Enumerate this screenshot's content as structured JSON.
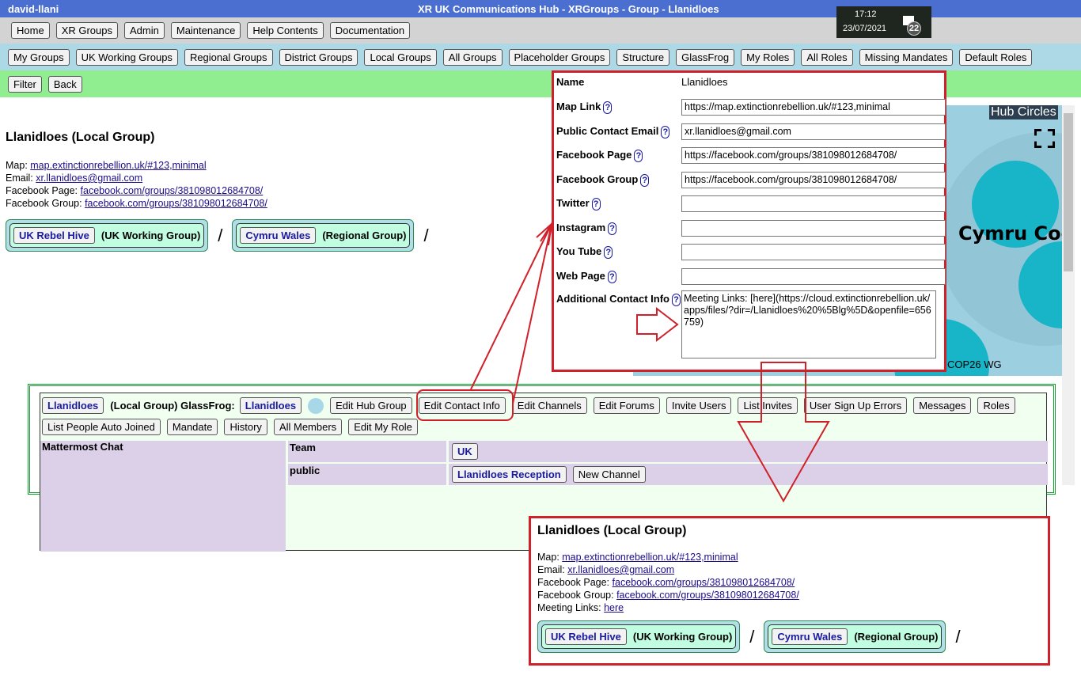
{
  "titlebar": {
    "user": "david-llani",
    "title": "XR UK Communications Hub - XRGroups - Group - Llanidloes"
  },
  "clock": {
    "time": "17:12",
    "date": "23/07/2021",
    "notifications": "22",
    "icon": "notification-icon"
  },
  "nav1": [
    "Home",
    "XR Groups",
    "Admin",
    "Maintenance",
    "Help Contents",
    "Documentation"
  ],
  "nav2": [
    "My Groups",
    "UK Working Groups",
    "Regional Groups",
    "District Groups",
    "Local Groups",
    "All Groups",
    "Placeholder Groups",
    "Structure",
    "GlassFrog",
    "My Roles",
    "All Roles",
    "Missing Mandates",
    "Default Roles"
  ],
  "nav3": [
    "Filter",
    "Back"
  ],
  "group": {
    "title": "Llanidloes (Local Group)",
    "map_label": "Map: ",
    "map": "map.extinctionrebellion.uk/#123,minimal",
    "email_label": "Email: ",
    "email": "xr.llanidloes@gmail.com",
    "fbpage_label": "Facebook Page: ",
    "fbpage": "facebook.com/groups/381098012684708/",
    "fbgroup_label": "Facebook Group: ",
    "fbgroup": "facebook.com/groups/381098012684708/",
    "meeting_label": "Meeting Links: ",
    "meeting": "here",
    "parents": [
      {
        "name": "UK Rebel Hive",
        "type": "(UK Working Group)"
      },
      {
        "name": "Cymru Wales",
        "type": "(Regional Group)"
      }
    ],
    "separator": "/"
  },
  "form": {
    "help": "?",
    "name_label": "Name",
    "name_value": "Llanidloes",
    "fields": [
      {
        "label": "Map Link",
        "value": "https://map.extinctionrebellion.uk/#123,minimal"
      },
      {
        "label": "Public Contact Email",
        "value": "xr.llanidloes@gmail.com"
      },
      {
        "label": "Facebook Page",
        "value": "https://facebook.com/groups/381098012684708/"
      },
      {
        "label": "Facebook Group",
        "value": "https://facebook.com/groups/381098012684708/"
      },
      {
        "label": "Twitter",
        "value": ""
      },
      {
        "label": "Instagram",
        "value": ""
      },
      {
        "label": "You Tube",
        "value": ""
      },
      {
        "label": "Web Page",
        "value": ""
      }
    ],
    "additional_label": "Additional Contact Info",
    "additional_value": "Meeting Links: [here](https://cloud.extinctionrebellion.uk/apps/files/?dir=/Llanidloes%20%5Blg%5D&openfile=656759)"
  },
  "hub": {
    "title": "Hub Circles",
    "circle_label": "Cymru Coo",
    "small_label": "COP26 WG",
    "expand_icon": "fullscreen-icon"
  },
  "hubgroup": {
    "name": "Llanidloes",
    "type": "(Local Group) GlassFrog:",
    "glassfrog": "Llanidloes",
    "actions": [
      "Edit Hub Group",
      "Edit Contact Info",
      "Edit Channels",
      "Edit Forums",
      "Invite Users",
      "List Invites",
      "User Sign Up Errors",
      "Messages",
      "Roles",
      "List People Auto Joined",
      "Mandate",
      "History",
      "All Members",
      "Edit My Role"
    ],
    "chat_label": "Mattermost Chat",
    "rows": [
      {
        "label": "Team",
        "buttons": [
          "UK"
        ]
      },
      {
        "label": "public",
        "buttons": [
          "Llanidloes Reception",
          "New Channel"
        ]
      }
    ]
  },
  "colors": {
    "annotation": "#d0202a",
    "titlebar": "#4b6fd0",
    "nav2": "#add8e6",
    "nav3": "#90ee90"
  }
}
